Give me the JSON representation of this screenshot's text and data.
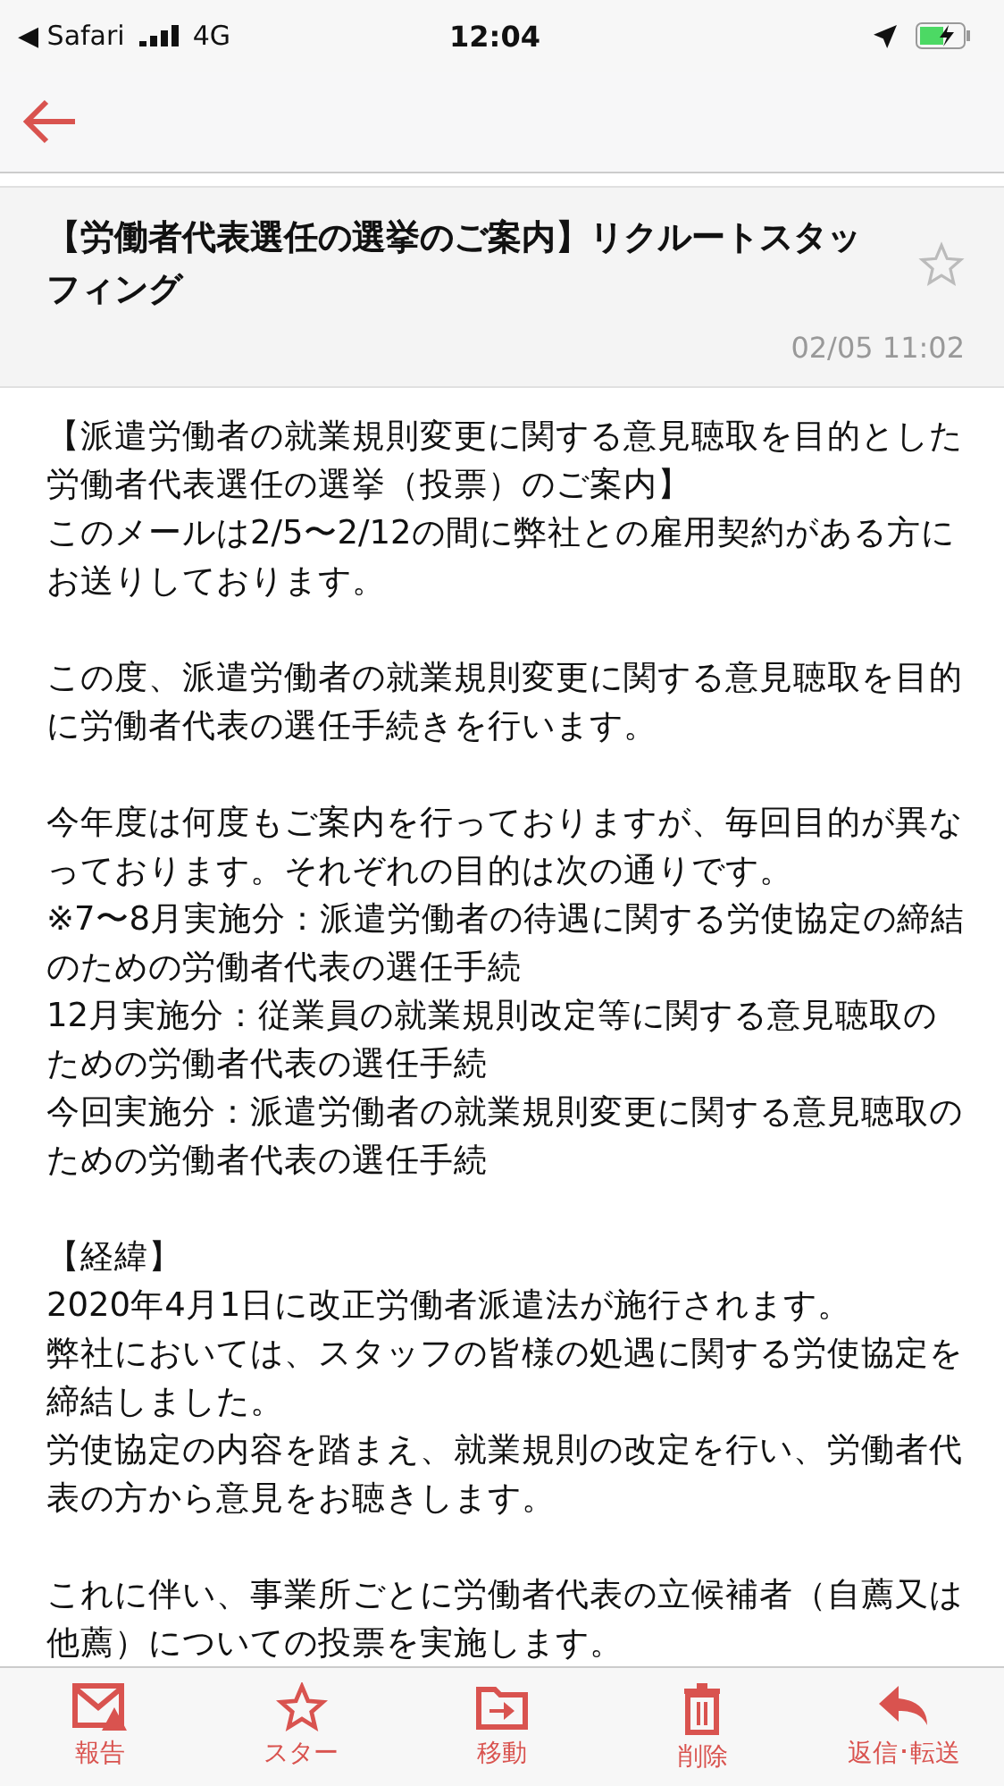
{
  "status_bar": {
    "back_app": "◀ Safari",
    "network": "4G",
    "time": "12:04"
  },
  "email": {
    "subject": "【労働者代表選任の選挙のご案内】リクルートスタッフィング",
    "starred": false,
    "date": "02/05 11:02",
    "paragraphs": [
      [
        "【派遣労働者の就業規則変更に関する意見聴取を目的とした労働者代表選任の選挙（投票）のご案内】",
        "このメールは2/5〜2/12の間に弊社との雇用契約がある方にお送りしております。"
      ],
      [
        "この度、派遣労働者の就業規則変更に関する意見聴取を目的に労働者代表の選任手続きを行います。"
      ],
      [
        "今年度は何度もご案内を行っておりますが、毎回目的が異なっております。それぞれの目的は次の通りです。",
        "※7〜8月実施分：派遣労働者の待遇に関する労使協定の締結のための労働者代表の選任手続",
        "12月実施分：従業員の就業規則改定等に関する意見聴取のための労働者代表の選任手続",
        "今回実施分：派遣労働者の就業規則変更に関する意見聴取のための労働者代表の選任手続"
      ],
      [
        "【経緯】",
        "2020年4月1日に改正労働者派遣法が施行されます。",
        "弊社においては、スタッフの皆様の処遇に関する労使協定を締結しました。",
        "労使協定の内容を踏まえ、就業規則の改定を行い、労働者代表の方から意見をお聴きします。"
      ],
      [
        "これに伴い、事業所ごとに労働者代表の立候補者（自薦又は他薦）についての投票を実施します。"
      ]
    ]
  },
  "toolbar": [
    {
      "kind": "report",
      "label": "報告"
    },
    {
      "kind": "star",
      "label": "スター"
    },
    {
      "kind": "move",
      "label": "移動"
    },
    {
      "kind": "delete",
      "label": "削除"
    },
    {
      "kind": "reply",
      "label": "返信･転送"
    }
  ]
}
